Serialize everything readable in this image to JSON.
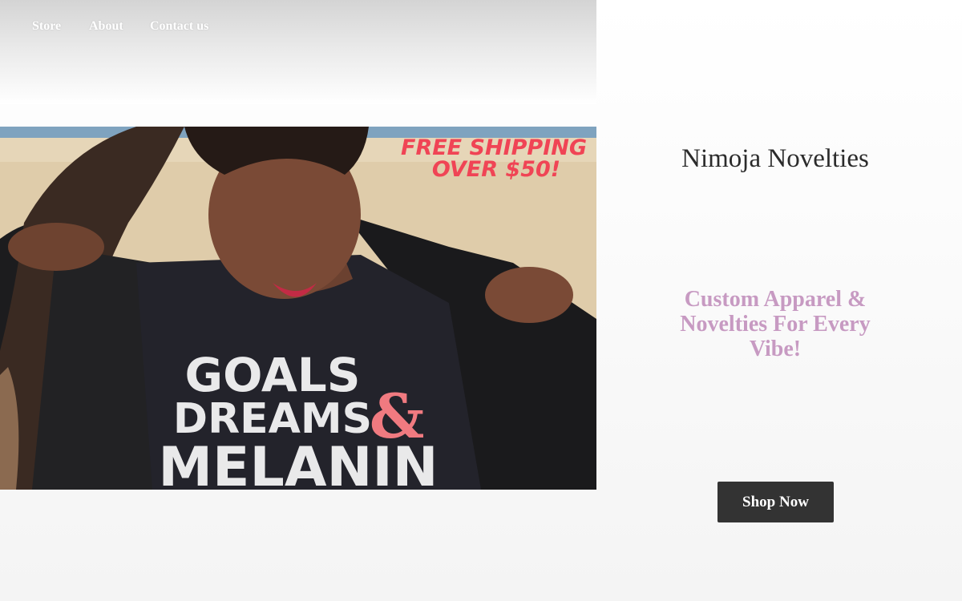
{
  "nav": {
    "items": [
      {
        "label": "Store"
      },
      {
        "label": "About"
      },
      {
        "label": "Contact us"
      }
    ]
  },
  "hero": {
    "image_description": "woman with braids wearing a black T-shirt under an open leather jacket",
    "promo_line1": "FREE SHIPPING",
    "promo_line2": "OVER $50!",
    "shirt_line1": "GOALS",
    "shirt_line2": "DREAMS",
    "shirt_amp": "&",
    "shirt_line3": "MELANIN"
  },
  "brand": {
    "title": "Nimoja Novelties",
    "tagline": "Custom Apparel & Novelties For Every Vibe!"
  },
  "cta": {
    "label": "Shop Now"
  },
  "colors": {
    "tagline": "#c79ac2",
    "button_bg": "#333333",
    "promo_red": "#f04455",
    "shirt_amp": "#f07a80"
  }
}
